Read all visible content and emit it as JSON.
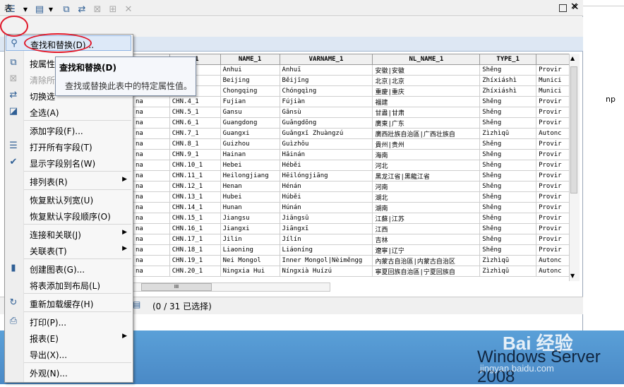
{
  "window": {
    "title": "表"
  },
  "menu": {
    "items": [
      {
        "label": "查找和替换(D)...",
        "icon": "binoculars-icon",
        "disabled": false,
        "submenu": false
      },
      {
        "label": "按属性选",
        "icon": "select-by-attributes-icon",
        "disabled": false,
        "submenu": false
      },
      {
        "label": "清除所",
        "icon": "clear-selection-icon",
        "disabled": true,
        "submenu": false
      },
      {
        "label": "切换选",
        "icon": "switch-selection-icon",
        "disabled": false,
        "submenu": false
      },
      {
        "label": "全选(A)",
        "icon": "select-all-icon",
        "disabled": false,
        "submenu": false
      },
      {
        "label": "添加字段(F)...",
        "icon": "",
        "disabled": false,
        "submenu": false
      },
      {
        "label": "打开所有字段(T)",
        "icon": "fields-icon",
        "disabled": false,
        "submenu": false
      },
      {
        "label": "显示字段别名(W)",
        "icon": "checkmark-icon",
        "disabled": false,
        "submenu": false
      },
      {
        "label": "排列表(R)",
        "icon": "",
        "disabled": false,
        "submenu": true
      },
      {
        "label": "恢复默认列宽(U)",
        "icon": "",
        "disabled": false,
        "submenu": false
      },
      {
        "label": "恢复默认字段顺序(O)",
        "icon": "",
        "disabled": false,
        "submenu": false
      },
      {
        "label": "连接和关联(J)",
        "icon": "",
        "disabled": false,
        "submenu": true
      },
      {
        "label": "关联表(T)",
        "icon": "",
        "disabled": false,
        "submenu": true
      },
      {
        "label": "创建图表(G)...",
        "icon": "bar-chart-icon",
        "disabled": false,
        "submenu": false
      },
      {
        "label": "将表添加到布局(L)",
        "icon": "",
        "disabled": false,
        "submenu": false
      },
      {
        "label": "重新加载缓存(H)",
        "icon": "refresh-icon",
        "disabled": false,
        "submenu": false
      },
      {
        "label": "打印(P)...",
        "icon": "printer-icon",
        "disabled": false,
        "submenu": false
      },
      {
        "label": "报表(E)",
        "icon": "",
        "disabled": false,
        "submenu": true
      },
      {
        "label": "导出(X)...",
        "icon": "",
        "disabled": false,
        "submenu": false
      },
      {
        "label": "外观(N)...",
        "icon": "",
        "disabled": false,
        "submenu": false
      }
    ]
  },
  "tooltip": {
    "title": "查找和替换(D)",
    "body": "查找或替换此表中的特定属性值。"
  },
  "table": {
    "columns": [
      "",
      "_1",
      "NAME_1",
      "VARNAME_1",
      "NL_NAME_1",
      "TYPE_1",
      ""
    ],
    "rows": [
      [
        "",
        "_1",
        "Anhui",
        "Anhuī",
        "安徽|安徽",
        "Shěng",
        "Provir"
      ],
      [
        "",
        "",
        "Beijing",
        "Běijīng",
        "北京|北京",
        "Zhíxiáshì",
        "Munici"
      ],
      [
        "",
        "",
        "Chongqing",
        "Chóngqìng",
        "重慶|重庆",
        "Zhíxiáshì",
        "Munici"
      ],
      [
        "na",
        "CHN.4_1",
        "Fujian",
        "Fújiàn",
        "福建",
        "Shěng",
        "Provir"
      ],
      [
        "na",
        "CHN.5_1",
        "Gansu",
        "Gānsù",
        "甘肅|甘肃",
        "Shěng",
        "Provir"
      ],
      [
        "na",
        "CHN.6_1",
        "Guangdong",
        "Guǎngdōng",
        "廣東|广东",
        "Shěng",
        "Provir"
      ],
      [
        "na",
        "CHN.7_1",
        "Guangxi",
        "Guǎngxī Zhuàngzú",
        "廣西壯族自治區|广西壮族自",
        "Zìzhìqū",
        "Autonc"
      ],
      [
        "na",
        "CHN.8_1",
        "Guizhou",
        "Guìzhōu",
        "貴州|贵州",
        "Shěng",
        "Provir"
      ],
      [
        "na",
        "CHN.9_1",
        "Hainan",
        "Hǎinán",
        "海南",
        "Shěng",
        "Provir"
      ],
      [
        "na",
        "CHN.10_1",
        "Hebei",
        "Héběi",
        "河北",
        "Shěng",
        "Provir"
      ],
      [
        "na",
        "CHN.11_1",
        "Heilongjiang",
        "Hēilóngjiāng",
        "黑龙江省|黑龍江省",
        "Shěng",
        "Provir"
      ],
      [
        "na",
        "CHN.12_1",
        "Henan",
        "Hénán",
        "河南",
        "Shěng",
        "Provir"
      ],
      [
        "na",
        "CHN.13_1",
        "Hubei",
        "Húběi",
        "湖北",
        "Shěng",
        "Provir"
      ],
      [
        "na",
        "CHN.14_1",
        "Hunan",
        "Húnán",
        "湖南",
        "Shěng",
        "Provir"
      ],
      [
        "na",
        "CHN.15_1",
        "Jiangsu",
        "Jiāngsū",
        "江蘇|江苏",
        "Shěng",
        "Provir"
      ],
      [
        "na",
        "CHN.16_1",
        "Jiangxi",
        "Jiāngxī",
        "江西",
        "Shěng",
        "Provir"
      ],
      [
        "na",
        "CHN.17_1",
        "Jilin",
        "Jílín",
        "吉林",
        "Shěng",
        "Provir"
      ],
      [
        "na",
        "CHN.18_1",
        "Liaoning",
        "Liáoníng",
        "遼寧|辽宁",
        "Shěng",
        "Provir"
      ],
      [
        "na",
        "CHN.19_1",
        "Nei Mongol",
        "Inner Mongol|Nèiměngg",
        "內蒙古自治區|内蒙古自治区",
        "Zìzhìqū",
        "Autonc"
      ],
      [
        "na",
        "CHN.20_1",
        "Ningxia Hui",
        "Níngxià Huízú",
        "寧夏回族自治區|宁夏回族自",
        "Zìzhìqū",
        "Autonc"
      ]
    ]
  },
  "status": {
    "selection": "(0 / 31 已选择)"
  },
  "scrollbar": {
    "thumb_glyph": "III"
  },
  "right_pane": {
    "text": "np"
  },
  "watermark": {
    "brand": "Bai 经验",
    "url": "jingyan.baidu.com"
  },
  "os": {
    "brand": "Windows Server 2008"
  },
  "colors": {
    "annotation": "#e0182a",
    "highlight": "#dde9f8",
    "desktop": "#4a89c6"
  }
}
